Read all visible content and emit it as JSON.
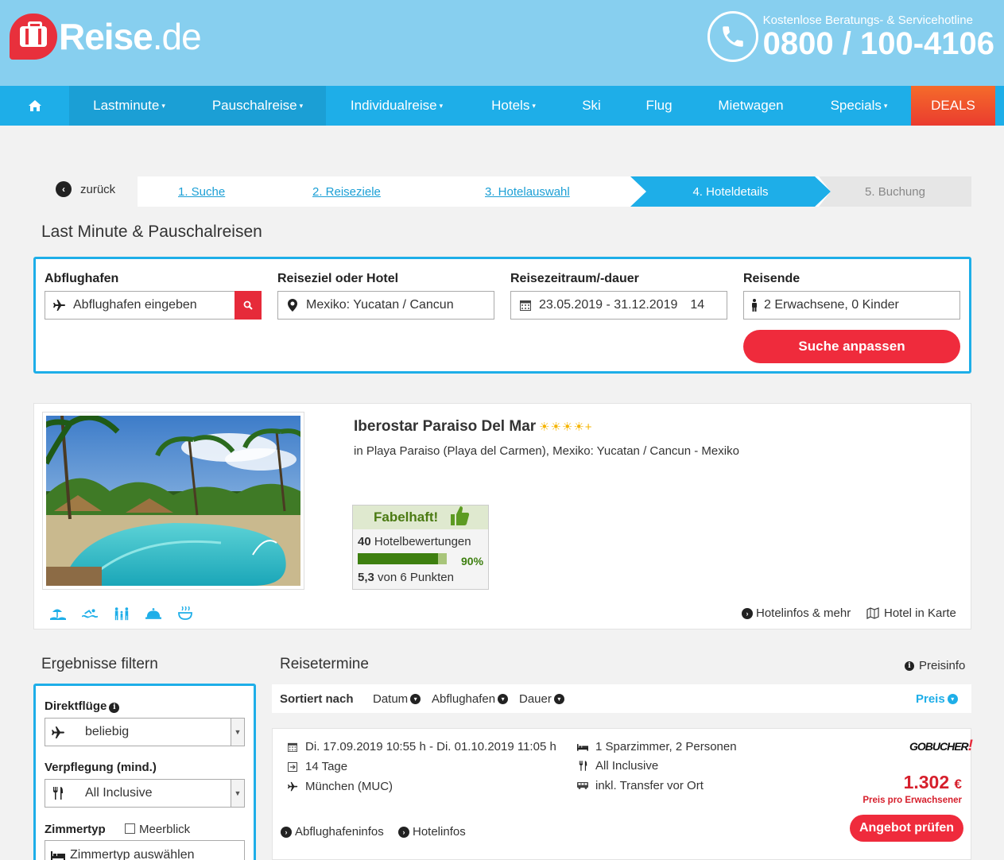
{
  "header": {
    "logo_main": "Reise",
    "logo_suffix": ".de",
    "hotline_label": "Kostenlose Beratungs- & Servicehotline",
    "hotline_number": "0800 / 100-4106"
  },
  "nav": {
    "items": [
      {
        "label": "Lastminute",
        "dropdown": true
      },
      {
        "label": "Pauschalreise",
        "dropdown": true
      },
      {
        "label": "Individualreise",
        "dropdown": true
      },
      {
        "label": "Hotels",
        "dropdown": true
      },
      {
        "label": "Ski",
        "dropdown": false
      },
      {
        "label": "Flug",
        "dropdown": false
      },
      {
        "label": "Mietwagen",
        "dropdown": false
      },
      {
        "label": "Specials",
        "dropdown": true
      },
      {
        "label": "DEALS",
        "dropdown": false
      }
    ]
  },
  "breadcrumb": {
    "back": "zurück",
    "steps": [
      "1. Suche",
      "2. Reiseziele",
      "3. Hotelauswahl",
      "4. Hoteldetails",
      "5. Buchung"
    ],
    "active_step": 4
  },
  "search": {
    "title": "Last Minute & Pauschalreisen",
    "departure_label": "Abflughafen",
    "departure_placeholder": "Abflughafen eingeben",
    "destination_label": "Reiseziel oder Hotel",
    "destination_value": "Mexiko: Yucatan / Cancun",
    "period_label": "Reisezeitraum/-dauer",
    "period_value": "23.05.2019 - 31.12.2019",
    "duration_value": "14",
    "travelers_label": "Reisende",
    "travelers_value": "2 Erwachsene, 0 Kinder",
    "submit_label": "Suche anpassen"
  },
  "hotel": {
    "name": "Iberostar Paraiso Del Mar",
    "stars": "☀☀☀☀+",
    "location": "in Playa Paraiso (Playa del Carmen), Mexiko: Yucatan / Cancun - Mexiko",
    "rating_word": "Fabelhaft!",
    "review_count": "40",
    "review_label": "Hotelbewertungen",
    "recommend_pct": 90,
    "recommend_pct_label": "90%",
    "points_value": "5,3",
    "points_label": "von 6 Punkten",
    "amenities": [
      "beach-icon",
      "swimming-icon",
      "family-icon",
      "room-service-icon",
      "spa-icon"
    ],
    "info_link": "Hotelinfos & mehr",
    "map_link": "Hotel in Karte"
  },
  "filter": {
    "title": "Ergebnisse filtern",
    "direct_label": "Direktflüge",
    "direct_value": "beliebig",
    "board_label": "Verpflegung (mind.)",
    "board_value": "All Inclusive",
    "room_label": "Zimmertyp",
    "seaview_label": "Meerblick",
    "room_placeholder": "Zimmertyp auswählen"
  },
  "results": {
    "title": "Reisetermine",
    "price_info": "Preisinfo",
    "sorted_by": "Sortiert nach",
    "sort_options": [
      "Datum",
      "Abflughafen",
      "Dauer"
    ],
    "sort_active": "Preis",
    "offers": [
      {
        "dates": "Di. 17.09.2019 10:55 h - Di. 01.10.2019 11:05 h",
        "duration": "14 Tage",
        "airport": "München (MUC)",
        "room": "1 Sparzimmer, 2 Personen",
        "board": "All Inclusive",
        "transfer": "inkl. Transfer vor Ort",
        "operator": "GOBUCHER",
        "price": "1.302",
        "currency": "€",
        "price_note": "Preis pro Erwachsener",
        "airport_info": "Abflughafeninfos",
        "hotel_info": "Hotelinfos",
        "cta": "Angebot prüfen"
      }
    ]
  },
  "colors": {
    "header_bg": "#87cfef",
    "nav_bg": "#1eaee8",
    "accent_red": "#ef2b3c",
    "rating_green": "#3d7f0f"
  }
}
